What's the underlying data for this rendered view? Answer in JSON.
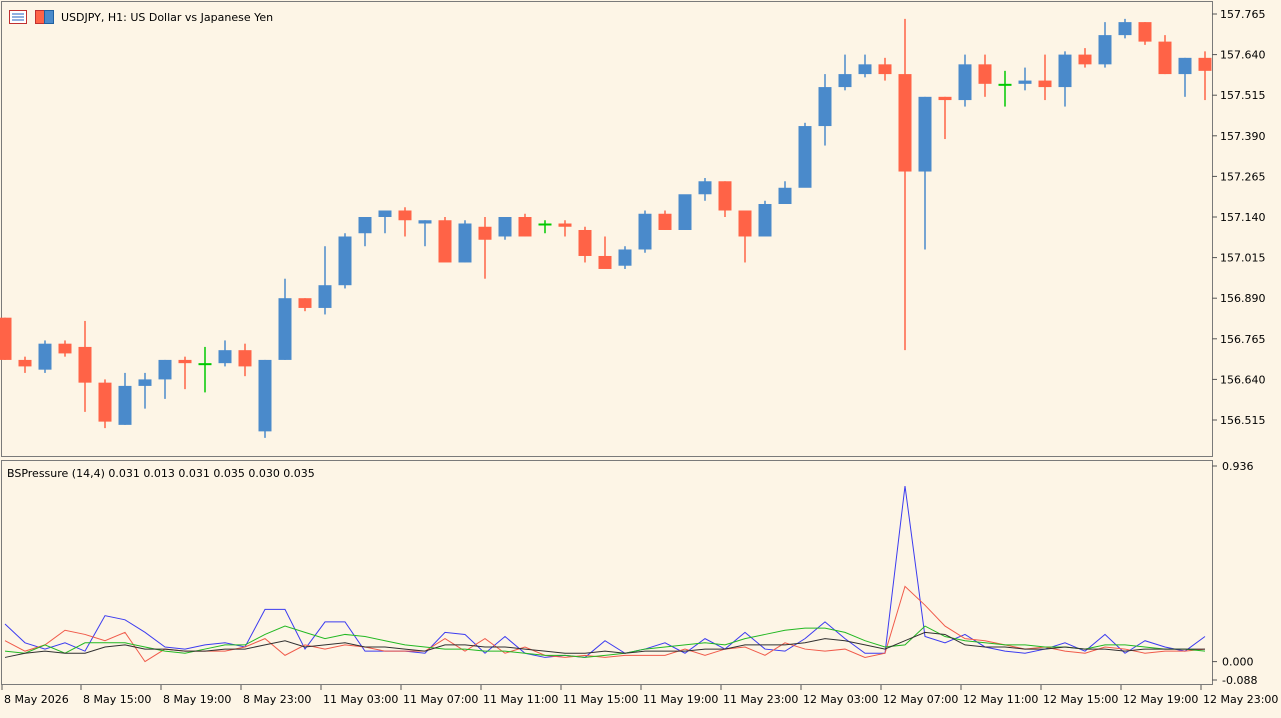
{
  "header": {
    "symbol_title": "USDJPY, H1:  US Dollar vs Japanese Yen",
    "icons": [
      "chart-menu-icon",
      "one-click-trading-icon"
    ]
  },
  "indicator": {
    "title": "BSPressure (14,4) 0.031 0.013 0.031 0.035 0.030 0.035"
  },
  "colors": {
    "background": "#fdf5e6",
    "bull": "#4a8acb",
    "bear": "#ff6347",
    "doji": "#00c800",
    "line_blue": "#3b3bf0",
    "line_red": "#f05a4a",
    "line_green": "#22b822",
    "line_black": "#303030"
  },
  "chart_data": [
    {
      "type": "candlestick",
      "title": "USDJPY, H1:  US Dollar vs Japanese Yen",
      "ylim": [
        156.45,
        157.78
      ],
      "y_ticks": [
        "157.765",
        "157.640",
        "157.515",
        "157.390",
        "157.265",
        "157.140",
        "157.015",
        "156.890",
        "156.765",
        "156.640",
        "156.515"
      ],
      "x_tick_labels": [
        "8 May 2026",
        "8 May 15:00",
        "8 May 19:00",
        "8 May 23:00",
        "11 May 03:00",
        "11 May 07:00",
        "11 May 11:00",
        "11 May 15:00",
        "11 May 19:00",
        "11 May 23:00",
        "12 May 03:00",
        "12 May 07:00",
        "12 May 11:00",
        "12 May 15:00",
        "12 May 19:00",
        "12 May 23:00"
      ],
      "candles": [
        [
          156.83,
          156.83,
          156.7,
          156.7
        ],
        [
          156.7,
          156.71,
          156.66,
          156.68
        ],
        [
          156.67,
          156.76,
          156.66,
          156.75
        ],
        [
          156.75,
          156.76,
          156.71,
          156.72
        ],
        [
          156.74,
          156.82,
          156.54,
          156.63
        ],
        [
          156.63,
          156.64,
          156.49,
          156.51
        ],
        [
          156.5,
          156.66,
          156.5,
          156.62
        ],
        [
          156.62,
          156.66,
          156.55,
          156.64
        ],
        [
          156.64,
          156.7,
          156.58,
          156.7
        ],
        [
          156.7,
          156.71,
          156.61,
          156.69
        ],
        [
          156.69,
          156.74,
          156.6,
          156.69
        ],
        [
          156.69,
          156.76,
          156.68,
          156.73
        ],
        [
          156.73,
          156.75,
          156.65,
          156.68
        ],
        [
          156.48,
          156.7,
          156.46,
          156.7
        ],
        [
          156.7,
          156.95,
          156.7,
          156.89
        ],
        [
          156.89,
          156.89,
          156.85,
          156.86
        ],
        [
          156.86,
          157.05,
          156.84,
          156.93
        ],
        [
          156.93,
          157.09,
          156.92,
          157.08
        ],
        [
          157.09,
          157.14,
          157.05,
          157.14
        ],
        [
          157.14,
          157.16,
          157.09,
          157.16
        ],
        [
          157.16,
          157.17,
          157.08,
          157.13
        ],
        [
          157.12,
          157.13,
          157.05,
          157.13
        ],
        [
          157.13,
          157.14,
          157.01,
          157.0
        ],
        [
          157.0,
          157.13,
          157.0,
          157.12
        ],
        [
          157.11,
          157.14,
          156.95,
          157.07
        ],
        [
          157.08,
          157.14,
          157.07,
          157.14
        ],
        [
          157.14,
          157.15,
          157.08,
          157.08
        ],
        [
          157.12,
          157.13,
          157.09,
          157.12
        ],
        [
          157.12,
          157.13,
          157.08,
          157.11
        ],
        [
          157.1,
          157.11,
          157.0,
          157.02
        ],
        [
          157.02,
          157.08,
          156.99,
          156.98
        ],
        [
          156.99,
          157.05,
          156.98,
          157.04
        ],
        [
          157.04,
          157.16,
          157.03,
          157.15
        ],
        [
          157.15,
          157.16,
          157.1,
          157.1
        ],
        [
          157.1,
          157.2,
          157.1,
          157.21
        ],
        [
          157.21,
          157.26,
          157.19,
          157.25
        ],
        [
          157.25,
          157.25,
          157.14,
          157.16
        ],
        [
          157.16,
          157.16,
          157.0,
          157.08
        ],
        [
          157.08,
          157.19,
          157.08,
          157.18
        ],
        [
          157.18,
          157.25,
          157.18,
          157.23
        ],
        [
          157.23,
          157.43,
          157.37,
          157.42
        ],
        [
          157.42,
          157.58,
          157.36,
          157.54
        ],
        [
          157.54,
          157.64,
          157.53,
          157.58
        ],
        [
          157.58,
          157.64,
          157.57,
          157.61
        ],
        [
          157.61,
          157.63,
          157.56,
          157.58
        ],
        [
          157.58,
          157.75,
          156.73,
          157.28
        ],
        [
          157.28,
          157.51,
          157.04,
          157.51
        ],
        [
          157.51,
          157.51,
          157.38,
          157.5
        ],
        [
          157.5,
          157.64,
          157.48,
          157.61
        ],
        [
          157.61,
          157.64,
          157.51,
          157.55
        ],
        [
          157.55,
          157.59,
          157.48,
          157.55
        ],
        [
          157.55,
          157.6,
          157.53,
          157.56
        ],
        [
          157.56,
          157.64,
          157.5,
          157.54
        ],
        [
          157.54,
          157.65,
          157.48,
          157.64
        ],
        [
          157.64,
          157.66,
          157.6,
          157.61
        ],
        [
          157.61,
          157.74,
          157.6,
          157.7
        ],
        [
          157.7,
          157.75,
          157.69,
          157.74
        ],
        [
          157.74,
          157.74,
          157.67,
          157.68
        ],
        [
          157.68,
          157.7,
          157.58,
          157.58
        ],
        [
          157.58,
          157.63,
          157.51,
          157.63
        ],
        [
          157.63,
          157.65,
          157.5,
          157.59
        ]
      ]
    },
    {
      "type": "line",
      "title": "BSPressure (14,4) 0.031 0.013 0.031 0.035 0.030 0.035",
      "ylim": [
        -0.088,
        0.936
      ],
      "y_ticks": [
        "0.936",
        "0.000",
        "-0.088"
      ],
      "series": [
        {
          "color": "#3b3bf0",
          "values": [
            0.18,
            0.09,
            0.06,
            0.09,
            0.05,
            0.22,
            0.2,
            0.14,
            0.07,
            0.06,
            0.08,
            0.09,
            0.07,
            0.25,
            0.25,
            0.06,
            0.19,
            0.19,
            0.05,
            0.05,
            0.05,
            0.04,
            0.14,
            0.13,
            0.04,
            0.12,
            0.04,
            0.02,
            0.03,
            0.02,
            0.1,
            0.04,
            0.06,
            0.09,
            0.04,
            0.11,
            0.06,
            0.14,
            0.06,
            0.05,
            0.11,
            0.19,
            0.11,
            0.04,
            0.04,
            0.84,
            0.12,
            0.09,
            0.13,
            0.07,
            0.05,
            0.04,
            0.06,
            0.09,
            0.05,
            0.13,
            0.04,
            0.1,
            0.07,
            0.05,
            0.12
          ]
        },
        {
          "color": "#f05a4a",
          "values": [
            0.1,
            0.05,
            0.08,
            0.15,
            0.13,
            0.1,
            0.14,
            0.0,
            0.06,
            0.05,
            0.05,
            0.05,
            0.07,
            0.11,
            0.03,
            0.08,
            0.06,
            0.08,
            0.07,
            0.05,
            0.05,
            0.05,
            0.11,
            0.05,
            0.11,
            0.04,
            0.07,
            0.03,
            0.02,
            0.03,
            0.02,
            0.03,
            0.03,
            0.03,
            0.06,
            0.03,
            0.06,
            0.07,
            0.03,
            0.09,
            0.06,
            0.05,
            0.06,
            0.02,
            0.04,
            0.36,
            0.27,
            0.17,
            0.11,
            0.1,
            0.08,
            0.06,
            0.07,
            0.05,
            0.04,
            0.07,
            0.06,
            0.04,
            0.05,
            0.05,
            0.06
          ]
        },
        {
          "color": "#22b822",
          "values": [
            0.05,
            0.04,
            0.08,
            0.04,
            0.09,
            0.09,
            0.09,
            0.07,
            0.05,
            0.04,
            0.06,
            0.08,
            0.08,
            0.13,
            0.17,
            0.14,
            0.11,
            0.13,
            0.12,
            0.1,
            0.08,
            0.07,
            0.06,
            0.06,
            0.05,
            0.05,
            0.04,
            0.03,
            0.03,
            0.02,
            0.03,
            0.04,
            0.06,
            0.07,
            0.08,
            0.09,
            0.08,
            0.11,
            0.13,
            0.15,
            0.16,
            0.16,
            0.14,
            0.1,
            0.07,
            0.08,
            0.17,
            0.12,
            0.1,
            0.09,
            0.08,
            0.08,
            0.07,
            0.07,
            0.06,
            0.08,
            0.08,
            0.07,
            0.06,
            0.06,
            0.05
          ]
        },
        {
          "color": "#303030",
          "values": [
            0.02,
            0.04,
            0.05,
            0.04,
            0.04,
            0.07,
            0.08,
            0.06,
            0.06,
            0.05,
            0.05,
            0.06,
            0.06,
            0.08,
            0.1,
            0.07,
            0.08,
            0.09,
            0.07,
            0.07,
            0.06,
            0.05,
            0.08,
            0.08,
            0.07,
            0.07,
            0.06,
            0.05,
            0.04,
            0.04,
            0.05,
            0.04,
            0.05,
            0.05,
            0.05,
            0.06,
            0.06,
            0.08,
            0.08,
            0.08,
            0.09,
            0.11,
            0.1,
            0.08,
            0.06,
            0.1,
            0.14,
            0.13,
            0.08,
            0.07,
            0.07,
            0.06,
            0.06,
            0.07,
            0.06,
            0.06,
            0.05,
            0.06,
            0.06,
            0.06,
            0.06
          ]
        }
      ]
    }
  ]
}
